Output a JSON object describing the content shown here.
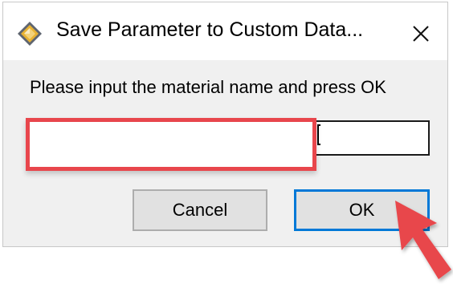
{
  "window": {
    "title": "Save Parameter to Custom Data...",
    "app_icon": "diamond-app-icon",
    "close_glyph": "✕"
  },
  "dialog": {
    "prompt": "Please input the material name and press OK",
    "material_name_value": "",
    "cancel_label": "Cancel",
    "ok_label": "OK"
  },
  "annotations": {
    "highlight_color": "#e8464c",
    "arrow_color": "#e8464c",
    "arrow_icon": "red-pointer-arrow"
  },
  "colors": {
    "ok_border": "#0078d7",
    "button_bg": "#e1e1e1",
    "dialog_bg": "#f0f0f0"
  }
}
